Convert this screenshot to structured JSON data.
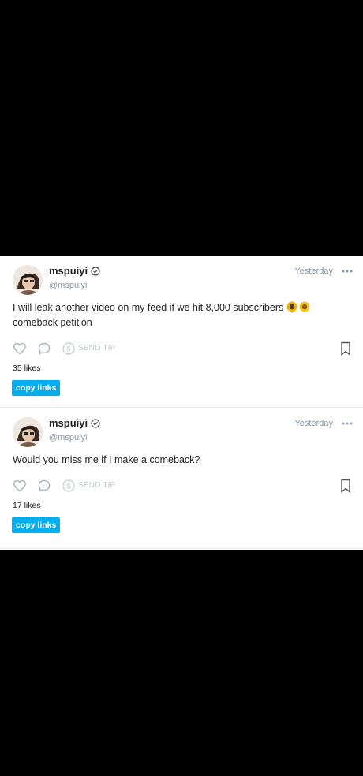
{
  "posts": [
    {
      "username": "mspuiyi",
      "handle": "@mspuiyi",
      "timestamp": "Yesterday",
      "text_before_emoji": "I will leak another video on my feed if we hit 8,000 subscribers",
      "text_after_emoji": "comeback petition",
      "emojis": [
        "sunflower-emoji",
        "sunflower-emoji"
      ],
      "tip_label": "SEND TIP",
      "likes": "35 likes",
      "copy_label": "copy links"
    },
    {
      "username": "mspuiyi",
      "handle": "@mspuiyi",
      "timestamp": "Yesterday",
      "text": "Would you miss me if I make a comeback?",
      "tip_label": "SEND TIP",
      "likes": "17 likes",
      "copy_label": "copy links"
    }
  ],
  "colors": {
    "accent": "#00aff0",
    "muted": "#8a96a3",
    "icon": "#c2cad2",
    "text": "#222222"
  }
}
